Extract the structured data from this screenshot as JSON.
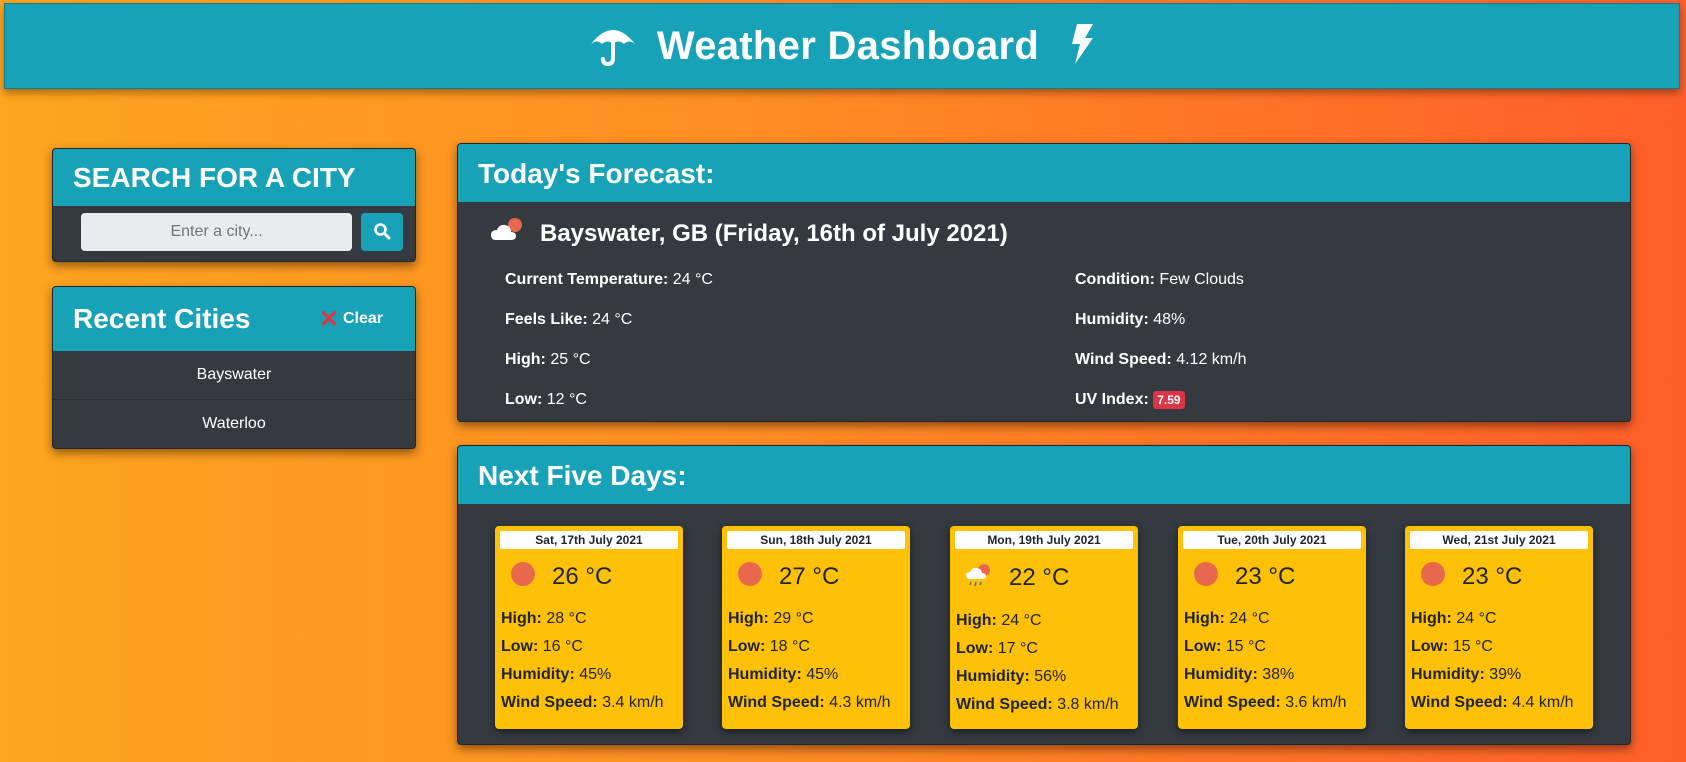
{
  "header": {
    "title": "Weather Dashboard",
    "left_icon": "umbrella-icon",
    "right_icon": "lightning-bolt-icon"
  },
  "search": {
    "title": "SEARCH FOR A CITY",
    "placeholder": "Enter a city...",
    "button_icon": "search-icon"
  },
  "recent": {
    "title": "Recent Cities",
    "clear_label": "Clear",
    "items": [
      {
        "label": "Bayswater"
      },
      {
        "label": "Waterloo"
      }
    ]
  },
  "today": {
    "title": "Today's Forecast:",
    "location": "Bayswater, GB (Friday, 16th of July 2021)",
    "icon": "few-clouds-icon",
    "current_temp_label": "Current Temperature:",
    "current_temp": "24 °C",
    "feels_like_label": "Feels Like:",
    "feels_like": "24 °C",
    "high_label": "High:",
    "high": "25 °C",
    "low_label": "Low:",
    "low": "12 °C",
    "condition_label": "Condition:",
    "condition": "Few Clouds",
    "humidity_label": "Humidity:",
    "humidity": "48%",
    "wind_label": "Wind Speed:",
    "wind": "4.12 km/h",
    "uv_label": "UV Index:",
    "uv": "7.59",
    "uv_color": "#dc3545"
  },
  "next": {
    "title": "Next Five Days:",
    "labels": {
      "high": "High:",
      "low": "Low:",
      "humidity": "Humidity:",
      "wind": "Wind Speed:"
    },
    "days": [
      {
        "date": "Sat, 17th July 2021",
        "icon": "clear-sun-icon",
        "temp": "26 °C",
        "high": "28 °C",
        "low": "16 °C",
        "humidity": "45%",
        "wind": "3.4 km/h"
      },
      {
        "date": "Sun, 18th July 2021",
        "icon": "clear-sun-icon",
        "temp": "27 °C",
        "high": "29 °C",
        "low": "18 °C",
        "humidity": "45%",
        "wind": "4.3 km/h"
      },
      {
        "date": "Mon, 19th July 2021",
        "icon": "rain-cloud-icon",
        "temp": "22 °C",
        "high": "24 °C",
        "low": "17 °C",
        "humidity": "56%",
        "wind": "3.8 km/h"
      },
      {
        "date": "Tue, 20th July 2021",
        "icon": "clear-sun-icon",
        "temp": "23 °C",
        "high": "24 °C",
        "low": "15 °C",
        "humidity": "38%",
        "wind": "3.6 km/h"
      },
      {
        "date": "Wed, 21st July 2021",
        "icon": "clear-sun-icon",
        "temp": "23 °C",
        "high": "24 °C",
        "low": "15 °C",
        "humidity": "39%",
        "wind": "4.4 km/h"
      }
    ]
  },
  "colors": {
    "primary": "#17a2b8",
    "card_bg": "#343a40",
    "day_card": "#ffc107",
    "sun": "#e8684d"
  }
}
